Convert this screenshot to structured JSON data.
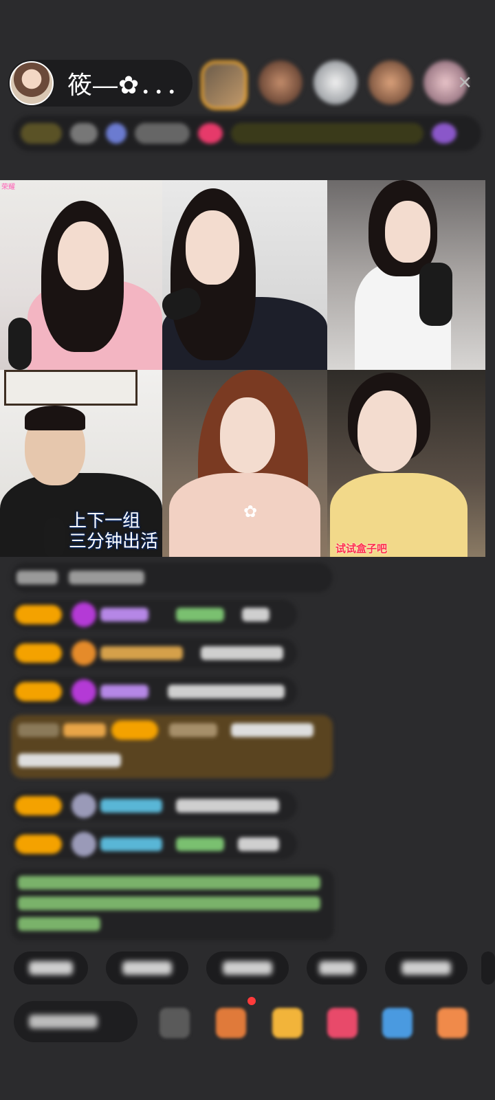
{
  "header": {
    "host_name": "筱—✿．．．",
    "close_icon": "×"
  },
  "grid": {
    "tile1_badge": "荣耀",
    "tile4_subtitle_line1": "上下一组",
    "tile4_subtitle_line2": "三分钟出活",
    "tile6_tag": "试试盒子吧"
  },
  "colors": {
    "background": "#2b2b2d",
    "level_badge": "#f4a200",
    "tag_red": "#ff2b4d"
  },
  "icons": {
    "close": "close-icon",
    "gift": "gift-icon",
    "more": "more-icon"
  }
}
